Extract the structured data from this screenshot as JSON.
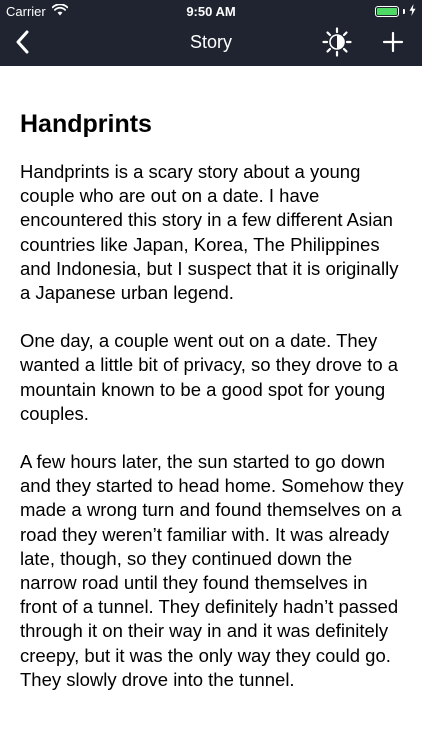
{
  "status": {
    "carrier": "Carrier",
    "time": "9:50 AM",
    "battery_level": 1.0
  },
  "nav": {
    "title": "Story",
    "back_icon": "chevron-left-icon",
    "brightness_icon": "brightness-icon",
    "add_icon": "plus-icon"
  },
  "story": {
    "title": "Handprints",
    "paragraphs": [
      "Handprints is a scary story about a young couple who are out on a date. I have encountered this story in a few different Asian countries like Japan, Korea, The Philippines and Indonesia, but I suspect that it is originally a Japanese urban legend.",
      "One day, a couple went out on a date. They wanted a little bit of privacy, so they drove to a mountain known to be a good spot for young couples.",
      "A few hours later, the sun started to go down and they started to head home. Somehow they made a wrong turn and found themselves on a road they weren’t familiar with. It was already late, though, so they continued down the narrow road until they found themselves in front of a tunnel. They definitely hadn’t passed through it on their way in and it was definitely creepy, but it was the only way they could go. They slowly drove into the tunnel."
    ]
  }
}
